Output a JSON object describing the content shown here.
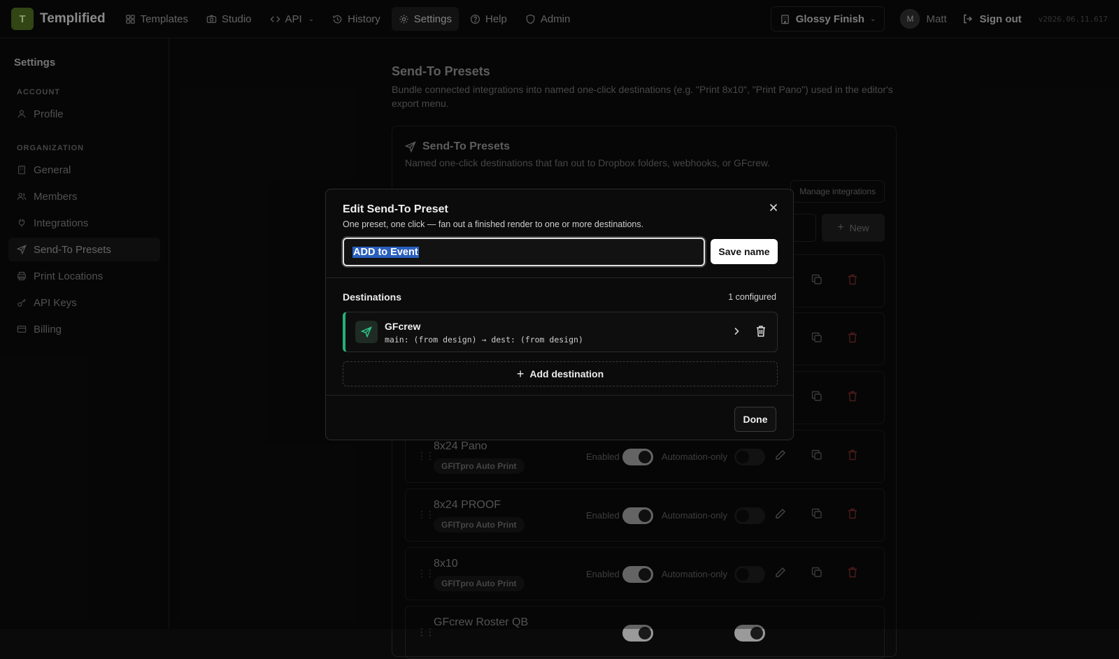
{
  "topbar": {
    "logo_letter": "T",
    "brand": "Templified",
    "nav": [
      {
        "label": "Templates",
        "icon": "grid-icon"
      },
      {
        "label": "Studio",
        "icon": "camera-icon"
      },
      {
        "label": "API",
        "icon": "code-icon"
      },
      {
        "label": "History",
        "icon": "history-icon"
      },
      {
        "label": "Settings",
        "icon": "gear-icon"
      },
      {
        "label": "Help",
        "icon": "help-icon"
      },
      {
        "label": "Admin",
        "icon": "shield-icon"
      }
    ],
    "org": "Glossy Finish",
    "avatar_letter": "M",
    "user": "Matt",
    "signout": "Sign out",
    "version": "v2026.06.11.617"
  },
  "sidebar": {
    "title": "Settings",
    "account_label": "ACCOUNT",
    "account_items": [
      {
        "label": "Profile",
        "icon": "user-icon"
      }
    ],
    "org_label": "ORGANIZATION",
    "org_items": [
      {
        "label": "General",
        "icon": "building-icon"
      },
      {
        "label": "Members",
        "icon": "users-icon"
      },
      {
        "label": "Integrations",
        "icon": "plug-icon"
      },
      {
        "label": "Send-To Presets",
        "icon": "send-icon"
      },
      {
        "label": "Print Locations",
        "icon": "printer-icon"
      },
      {
        "label": "API Keys",
        "icon": "key-icon"
      },
      {
        "label": "Billing",
        "icon": "card-icon"
      }
    ]
  },
  "main": {
    "title": "Send-To Presets",
    "description": "Bundle connected integrations into named one-click destinations (e.g. \"Print 8x10\", \"Print Pano\") used in the editor's export menu.",
    "card_title": "Send-To Presets",
    "card_description": "Named one-click destinations that fan out to Dropbox folders, webhooks, or GFcrew.",
    "manage_label": "Manage integrations",
    "new_label": "New",
    "enabled_label": "Enabled",
    "automation_label": "Automation-only",
    "rows": [
      {
        "name": "8x24 Pano",
        "tag": "GFITpro Auto Print"
      },
      {
        "name": "8x24 PROOF",
        "tag": "GFITpro Auto Print"
      },
      {
        "name": "8x10",
        "tag": "GFITpro Auto Print"
      },
      {
        "name": "GFcrew Roster QB",
        "tag": ""
      }
    ]
  },
  "modal": {
    "title": "Edit Send-To Preset",
    "subtitle": "One preset, one click — fan out a finished render to one or more destinations.",
    "name_value": "ADD to Event",
    "save_name": "Save name",
    "destinations_title": "Destinations",
    "destinations_count": "1 configured",
    "destination": {
      "name": "GFcrew",
      "meta": "main: (from design) → dest: (from design)",
      "accent": "#25b07a"
    },
    "add_destination": "Add destination",
    "done": "Done"
  }
}
